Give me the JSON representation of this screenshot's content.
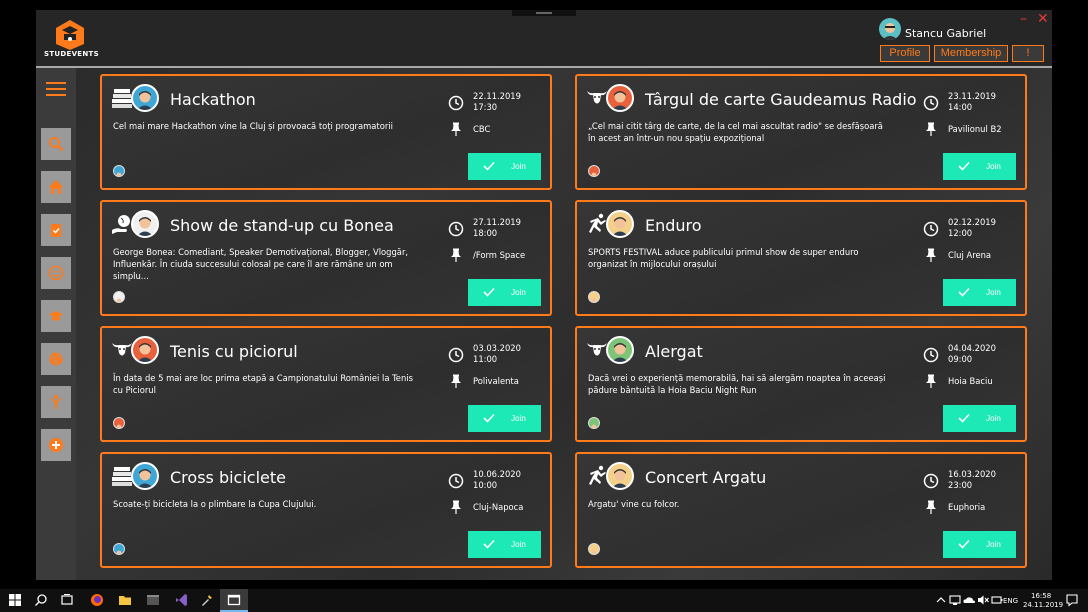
{
  "app": {
    "logo_text": "STUDEVENTS",
    "user_name": "Stancu Gabriel",
    "buttons": {
      "profile": "Profile",
      "membership": "Membership",
      "alert": "!"
    },
    "window_controls": {
      "minimize": "–",
      "close": "✕"
    }
  },
  "colors": {
    "accent": "#ff7a1a",
    "join": "#1de9b6",
    "card_bg": "#333333"
  },
  "sidebar": {
    "items": [
      {
        "icon": "search-icon"
      },
      {
        "icon": "home-icon"
      },
      {
        "icon": "checklist-icon"
      },
      {
        "icon": "smiley-icon"
      },
      {
        "icon": "graduation-cap-icon"
      },
      {
        "icon": "globe-icon"
      },
      {
        "icon": "person-icon"
      },
      {
        "icon": "add-icon"
      }
    ]
  },
  "events": [
    {
      "title": "Hackathon",
      "desc": "Cel mai mare Hackathon vine la Cluj și provoacă toți programatorii",
      "date": "22.11.2019",
      "time": "17:30",
      "location": "CBC",
      "join": "Join",
      "category_icon": "books-icon",
      "avatar_color": "#3fa7d6"
    },
    {
      "title": "Târgul de carte Gaudeamus Radio",
      "desc": "„Cel mai citit târg de carte, de la cel mai ascultat radio\" se desfășoară în acest an într-un nou spațiu expozițional",
      "date": "23.11.2019",
      "time": "14:00",
      "location": "Pavilionul B2",
      "join": "Join",
      "category_icon": "bull-icon",
      "avatar_color": "#e8613c"
    },
    {
      "title": "Show de stand-up cu Bonea",
      "desc": "George Bonea: Comediant, Speaker Demotivațional, Blogger, Vloggăr, Influenkăr. În ciuda succesului colosal pe care îl are rămâne un om simplu...",
      "date": "27.11.2019",
      "time": "18:00",
      "location": "/Form Space",
      "join": "Join",
      "category_icon": "globe-hand-icon",
      "avatar_color": "#f0f0f0"
    },
    {
      "title": "Enduro",
      "desc": "SPORTS FESTIVAL aduce publicului primul show de super enduro organizat în mijlocului orașului",
      "date": "02.12.2019",
      "time": "12:00",
      "location": "Cluj Arena",
      "join": "Join",
      "category_icon": "runner-icon",
      "avatar_color": "#f5d08a"
    },
    {
      "title": "Tenis cu piciorul",
      "desc": "În data de 5 mai are loc prima etapă a Campionatului României la Tenis cu Piciorul",
      "date": "03.03.2020",
      "time": "11:00",
      "location": "Polivalenta",
      "join": "Join",
      "category_icon": "bull-icon",
      "avatar_color": "#e8613c"
    },
    {
      "title": "Alergat",
      "desc": "Dacă vrei o experiență memorabilă, hai să alergăm noaptea în aceeași pădure bântuită la Hoia Baciu Night Run",
      "date": "04.04.2020",
      "time": "09:00",
      "location": "Hoia Baciu",
      "join": "Join",
      "category_icon": "bull-icon",
      "avatar_color": "#7cc576"
    },
    {
      "title": "Cross biciclete",
      "desc": "Scoate-ți bicicleta la o plimbare la Cupa Clujului.",
      "date": "10.06.2020",
      "time": "10:00",
      "location": "Cluj-Napoca",
      "join": "Join",
      "category_icon": "books-icon",
      "avatar_color": "#3fa7d6"
    },
    {
      "title": "Concert Argatu",
      "desc": "Argatu' vine cu folcor.",
      "date": "16.03.2020",
      "time": "23:00",
      "location": "Euphoria",
      "join": "Join",
      "category_icon": "runner-icon",
      "avatar_color": "#f5d08a"
    }
  ],
  "taskbar": {
    "language": "ENG",
    "time": "16:58",
    "date": "24.11.2019"
  }
}
